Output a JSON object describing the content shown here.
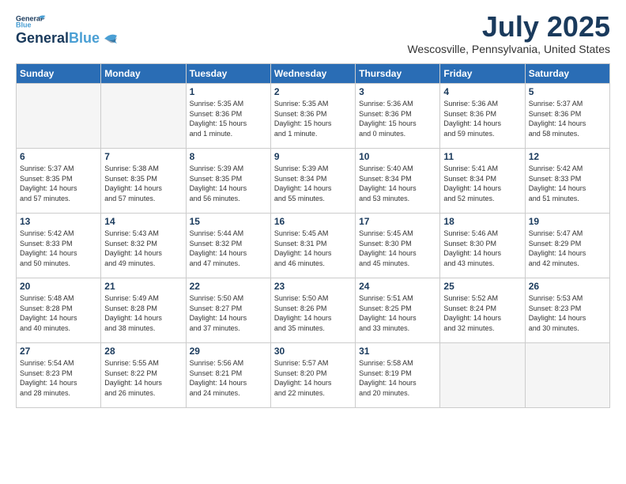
{
  "header": {
    "logo_line1": "General",
    "logo_line2": "Blue",
    "month_title": "July 2025",
    "location": "Wescosville, Pennsylvania, United States"
  },
  "days_of_week": [
    "Sunday",
    "Monday",
    "Tuesday",
    "Wednesday",
    "Thursday",
    "Friday",
    "Saturday"
  ],
  "weeks": [
    [
      {
        "day": "",
        "info": ""
      },
      {
        "day": "",
        "info": ""
      },
      {
        "day": "1",
        "info": "Sunrise: 5:35 AM\nSunset: 8:36 PM\nDaylight: 15 hours\nand 1 minute."
      },
      {
        "day": "2",
        "info": "Sunrise: 5:35 AM\nSunset: 8:36 PM\nDaylight: 15 hours\nand 1 minute."
      },
      {
        "day": "3",
        "info": "Sunrise: 5:36 AM\nSunset: 8:36 PM\nDaylight: 15 hours\nand 0 minutes."
      },
      {
        "day": "4",
        "info": "Sunrise: 5:36 AM\nSunset: 8:36 PM\nDaylight: 14 hours\nand 59 minutes."
      },
      {
        "day": "5",
        "info": "Sunrise: 5:37 AM\nSunset: 8:36 PM\nDaylight: 14 hours\nand 58 minutes."
      }
    ],
    [
      {
        "day": "6",
        "info": "Sunrise: 5:37 AM\nSunset: 8:35 PM\nDaylight: 14 hours\nand 57 minutes."
      },
      {
        "day": "7",
        "info": "Sunrise: 5:38 AM\nSunset: 8:35 PM\nDaylight: 14 hours\nand 57 minutes."
      },
      {
        "day": "8",
        "info": "Sunrise: 5:39 AM\nSunset: 8:35 PM\nDaylight: 14 hours\nand 56 minutes."
      },
      {
        "day": "9",
        "info": "Sunrise: 5:39 AM\nSunset: 8:34 PM\nDaylight: 14 hours\nand 55 minutes."
      },
      {
        "day": "10",
        "info": "Sunrise: 5:40 AM\nSunset: 8:34 PM\nDaylight: 14 hours\nand 53 minutes."
      },
      {
        "day": "11",
        "info": "Sunrise: 5:41 AM\nSunset: 8:34 PM\nDaylight: 14 hours\nand 52 minutes."
      },
      {
        "day": "12",
        "info": "Sunrise: 5:42 AM\nSunset: 8:33 PM\nDaylight: 14 hours\nand 51 minutes."
      }
    ],
    [
      {
        "day": "13",
        "info": "Sunrise: 5:42 AM\nSunset: 8:33 PM\nDaylight: 14 hours\nand 50 minutes."
      },
      {
        "day": "14",
        "info": "Sunrise: 5:43 AM\nSunset: 8:32 PM\nDaylight: 14 hours\nand 49 minutes."
      },
      {
        "day": "15",
        "info": "Sunrise: 5:44 AM\nSunset: 8:32 PM\nDaylight: 14 hours\nand 47 minutes."
      },
      {
        "day": "16",
        "info": "Sunrise: 5:45 AM\nSunset: 8:31 PM\nDaylight: 14 hours\nand 46 minutes."
      },
      {
        "day": "17",
        "info": "Sunrise: 5:45 AM\nSunset: 8:30 PM\nDaylight: 14 hours\nand 45 minutes."
      },
      {
        "day": "18",
        "info": "Sunrise: 5:46 AM\nSunset: 8:30 PM\nDaylight: 14 hours\nand 43 minutes."
      },
      {
        "day": "19",
        "info": "Sunrise: 5:47 AM\nSunset: 8:29 PM\nDaylight: 14 hours\nand 42 minutes."
      }
    ],
    [
      {
        "day": "20",
        "info": "Sunrise: 5:48 AM\nSunset: 8:28 PM\nDaylight: 14 hours\nand 40 minutes."
      },
      {
        "day": "21",
        "info": "Sunrise: 5:49 AM\nSunset: 8:28 PM\nDaylight: 14 hours\nand 38 minutes."
      },
      {
        "day": "22",
        "info": "Sunrise: 5:50 AM\nSunset: 8:27 PM\nDaylight: 14 hours\nand 37 minutes."
      },
      {
        "day": "23",
        "info": "Sunrise: 5:50 AM\nSunset: 8:26 PM\nDaylight: 14 hours\nand 35 minutes."
      },
      {
        "day": "24",
        "info": "Sunrise: 5:51 AM\nSunset: 8:25 PM\nDaylight: 14 hours\nand 33 minutes."
      },
      {
        "day": "25",
        "info": "Sunrise: 5:52 AM\nSunset: 8:24 PM\nDaylight: 14 hours\nand 32 minutes."
      },
      {
        "day": "26",
        "info": "Sunrise: 5:53 AM\nSunset: 8:23 PM\nDaylight: 14 hours\nand 30 minutes."
      }
    ],
    [
      {
        "day": "27",
        "info": "Sunrise: 5:54 AM\nSunset: 8:23 PM\nDaylight: 14 hours\nand 28 minutes."
      },
      {
        "day": "28",
        "info": "Sunrise: 5:55 AM\nSunset: 8:22 PM\nDaylight: 14 hours\nand 26 minutes."
      },
      {
        "day": "29",
        "info": "Sunrise: 5:56 AM\nSunset: 8:21 PM\nDaylight: 14 hours\nand 24 minutes."
      },
      {
        "day": "30",
        "info": "Sunrise: 5:57 AM\nSunset: 8:20 PM\nDaylight: 14 hours\nand 22 minutes."
      },
      {
        "day": "31",
        "info": "Sunrise: 5:58 AM\nSunset: 8:19 PM\nDaylight: 14 hours\nand 20 minutes."
      },
      {
        "day": "",
        "info": ""
      },
      {
        "day": "",
        "info": ""
      }
    ]
  ]
}
